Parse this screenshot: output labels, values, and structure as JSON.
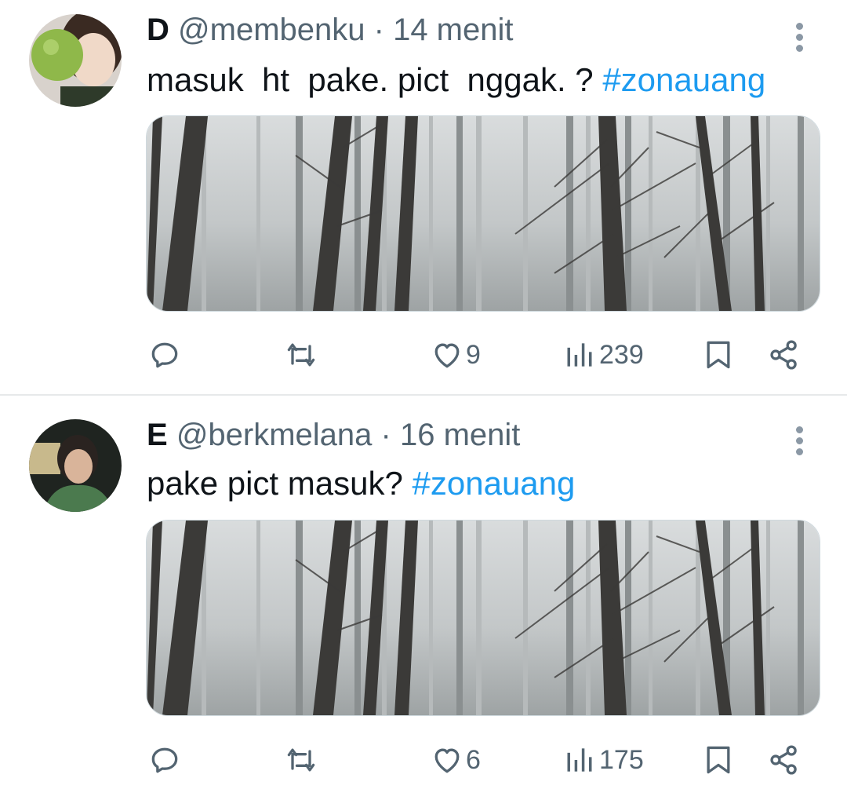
{
  "tweets": [
    {
      "name": "D",
      "handle": "@membenku",
      "dot": "·",
      "time": "14 menit",
      "text": "masuk  ht  pake. pict  nggak. ? ",
      "hashtag": "#zonauang",
      "likes": "9",
      "views": "239"
    },
    {
      "name": "E",
      "handle": "@berkmelana",
      "dot": "·",
      "time": "16 menit",
      "text": "pake pict masuk? ",
      "hashtag": "#zonauang",
      "likes": "6",
      "views": "175"
    }
  ],
  "icons": {
    "reply": "reply-icon",
    "retweet": "retweet-icon",
    "like": "heart-icon",
    "views": "views-icon",
    "bookmark": "bookmark-icon",
    "share": "share-icon",
    "more": "more-vertical-icon"
  },
  "colors": {
    "accent": "#1d9bf0",
    "muted": "#536471",
    "divider": "#e7e9ea"
  }
}
